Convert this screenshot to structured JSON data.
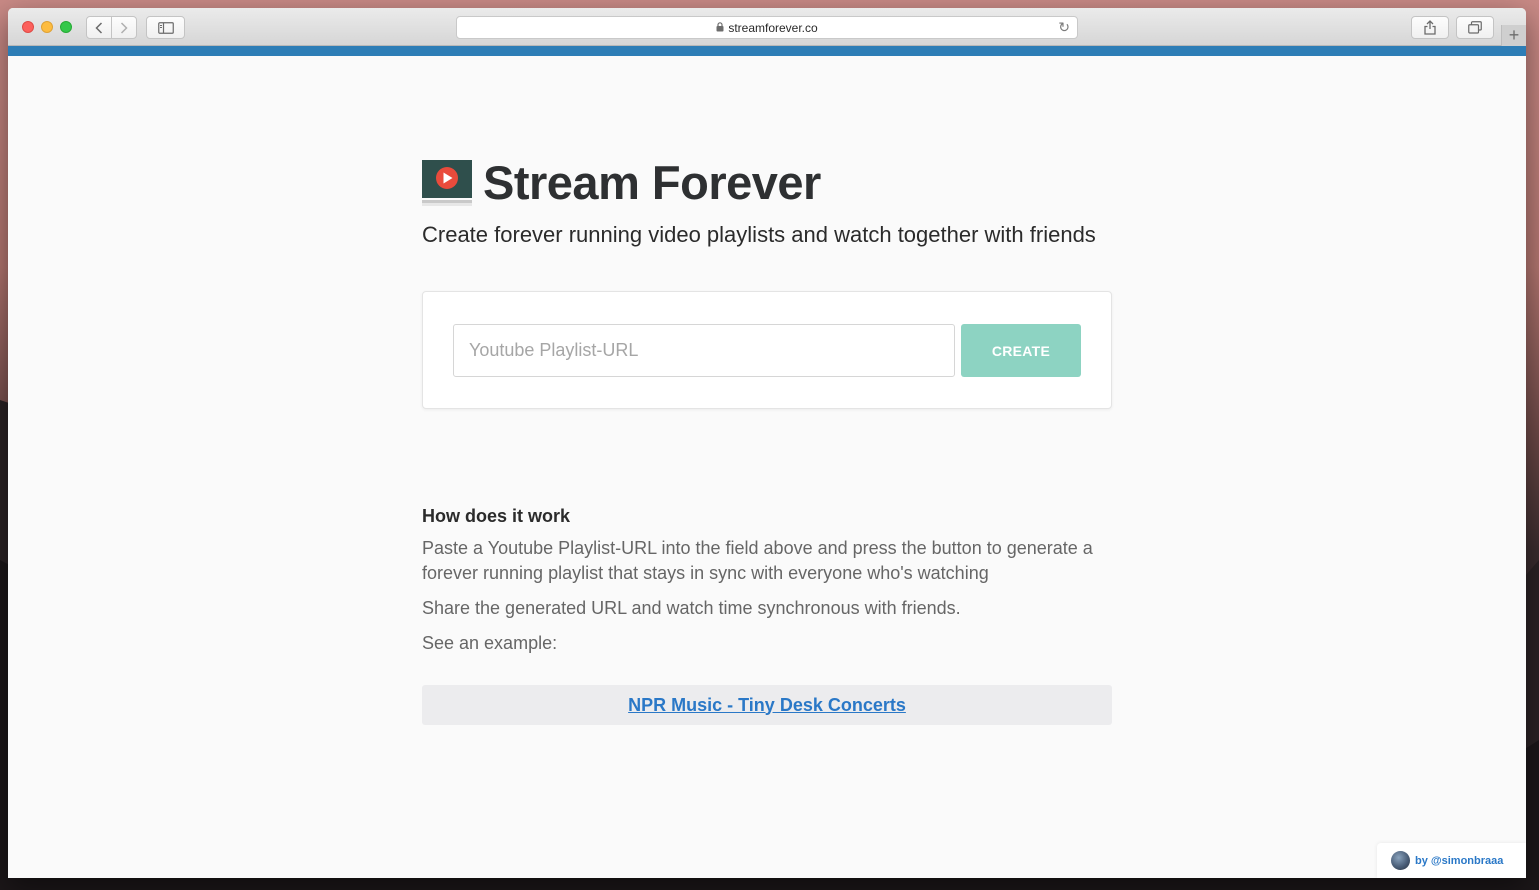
{
  "browser": {
    "address": "streamforever.co",
    "accent_color": "#2d7db6"
  },
  "header": {
    "title": "Stream Forever",
    "tagline": "Create forever running video playlists and watch together with friends"
  },
  "form": {
    "url_placeholder": "Youtube Playlist-URL",
    "url_value": "",
    "create_label": "CREATE",
    "button_color": "#8dd3c2"
  },
  "how": {
    "title": "How does it work",
    "p1": "Paste a Youtube Playlist-URL into the field above and press the button to generate a forever running playlist that stays in sync with everyone who's watching",
    "p2": "Share the generated URL and watch time synchronous with friends.",
    "p3": "See an example:",
    "example_link": "NPR Music - Tiny Desk Concerts"
  },
  "footer": {
    "credit": "by @simonbraaa"
  }
}
